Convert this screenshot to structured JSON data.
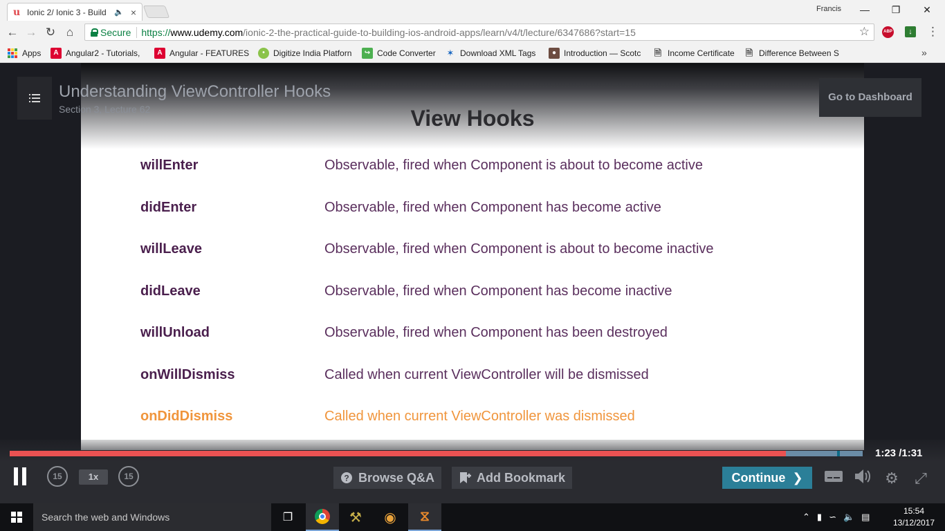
{
  "browser": {
    "tab_title": "Ionic 2/ Ionic 3 - Build",
    "profile_name": "Francis",
    "secure_label": "Secure",
    "url_proto": "https://",
    "url_host": "www.udemy.com",
    "url_path": "/ionic-2-the-practical-guide-to-building-ios-android-apps/learn/v4/t/lecture/6347686?start=15",
    "bookmarks": [
      {
        "label": "Apps",
        "icon": "apps-icon"
      },
      {
        "label": "Angular2 - Tutorials,",
        "icon": "angular-icon",
        "color": "#dd0031"
      },
      {
        "label": "Angular - FEATURES",
        "icon": "angular-icon",
        "color": "#dd0031"
      },
      {
        "label": "Digitize India Platforn",
        "icon": "digitize-icon",
        "color": "#8bc34a"
      },
      {
        "label": "Code Converter",
        "icon": "code-converter-icon",
        "color": "#4caf50"
      },
      {
        "label": "Download XML Tags",
        "icon": "xml-icon",
        "color": "#1565c0"
      },
      {
        "label": "Introduction — Scotc",
        "icon": "scotch-icon",
        "color": "#6d4c41"
      },
      {
        "label": "Income Certificate",
        "icon": "page-icon"
      },
      {
        "label": "Difference Between S",
        "icon": "page-icon"
      }
    ]
  },
  "player": {
    "lecture_title": "Understanding ViewController Hooks",
    "lecture_sub": "Section 3, Lecture 62",
    "dashboard_label": "Go to Dashboard",
    "slide": {
      "heading": "View Hooks",
      "hooks": [
        {
          "name": "willEnter",
          "desc": "Observable, fired when Component is about to become active"
        },
        {
          "name": "didEnter",
          "desc": "Observable, fired when Component has become active"
        },
        {
          "name": "willLeave",
          "desc": "Observable, fired when Component is about to become inactive"
        },
        {
          "name": "didLeave",
          "desc": "Observable, fired when Component has become inactive"
        },
        {
          "name": "willUnload",
          "desc": "Observable, fired when Component has been destroyed"
        },
        {
          "name": "onWillDismiss",
          "desc": "Called when current ViewController will be dismissed"
        },
        {
          "name": "onDidDismiss",
          "desc": "Called when current ViewController was dismissed"
        }
      ]
    },
    "progress_fraction": 0.91,
    "buffer_marker_fraction": 0.97,
    "current_time": "1:23",
    "total_time": "/1:31",
    "skip_back_label": "15",
    "skip_forward_label": "15",
    "speed_label": "1x",
    "browse_qa_label": "Browse Q&A",
    "bookmark_label": "Add Bookmark",
    "continue_label": "Continue"
  },
  "taskbar": {
    "search_placeholder": "Search the web and Windows",
    "time": "15:54",
    "date": "13/12/2017"
  },
  "colors": {
    "hook_name": "#4a1f4d",
    "hook_highlight": "#f0953c",
    "progress": "#ea5252",
    "continue": "#2b7f98"
  }
}
